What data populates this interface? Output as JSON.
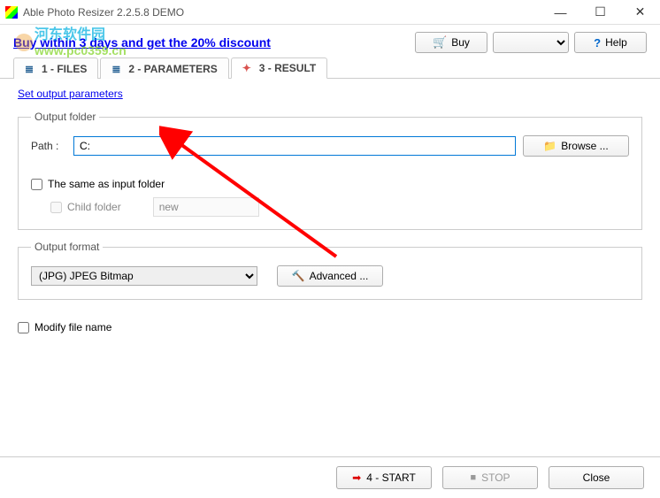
{
  "window": {
    "title": "Able Photo Resizer 2.2.5.8 DEMO"
  },
  "promo": {
    "link_text": "Buy within 3 days and get the 20% discount"
  },
  "watermark": {
    "line1": "河东软件园",
    "line2": "www.pc0359.cn"
  },
  "topbuttons": {
    "buy": "Buy",
    "help": "Help"
  },
  "tabs": {
    "files": "1 - FILES",
    "parameters": "2 - PARAMETERS",
    "result": "3 - RESULT"
  },
  "content": {
    "set_output_link": "Set output parameters",
    "output_folder_legend": "Output folder",
    "path_label": "Path :",
    "path_value": "C:",
    "browse_label": "Browse ...",
    "same_folder_label": "The same as input folder",
    "child_folder_label": "Child folder",
    "child_folder_value": "new",
    "output_format_legend": "Output format",
    "format_selected": "(JPG) JPEG Bitmap",
    "advanced_label": "Advanced ...",
    "modify_label": "Modify file name"
  },
  "bottom": {
    "start": "4 - START",
    "stop": "STOP",
    "close": "Close"
  }
}
